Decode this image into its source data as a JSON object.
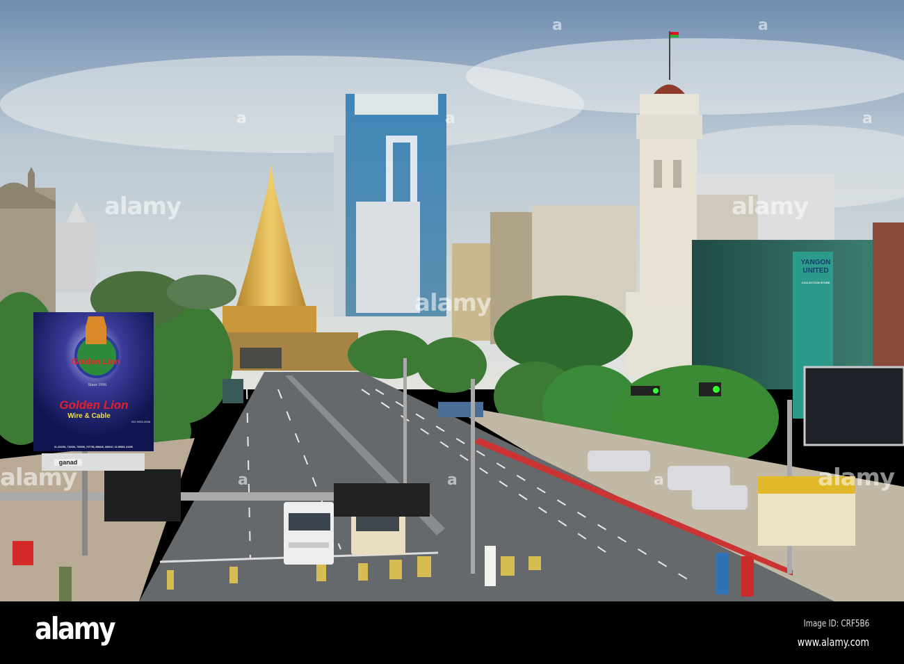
{
  "photo": {
    "description_alt": "Street view toward golden pagoda",
    "billboard_golden_lion": {
      "logo_text": "Golden Lion",
      "since": "Since 1996",
      "title": "Golden Lion",
      "subtitle": "Wire & Cable",
      "certification": "ISO 9001:2008",
      "phones": "01-224351, 710064, 705398, 707755, 666840, 685947, 02-65835, 61290"
    },
    "billboard_yangon_united": {
      "title_line1": "YANGON",
      "title_line2": "UNITED",
      "subtitle": "COLLECTION STORE"
    },
    "shop_sign": "ganad",
    "colors": {
      "sky_top": "#6f8db0",
      "sky_bottom": "#dfe3e4",
      "road": "#5f6368",
      "pagoda": "#d4a640",
      "tree": "#3f7a3a",
      "footer": "#000000"
    }
  },
  "watermark": {
    "text": "alamy",
    "letter": "a"
  },
  "footer": {
    "logo": "alamy",
    "image_id": "Image ID: CRF5B6",
    "url": "www.alamy.com"
  }
}
